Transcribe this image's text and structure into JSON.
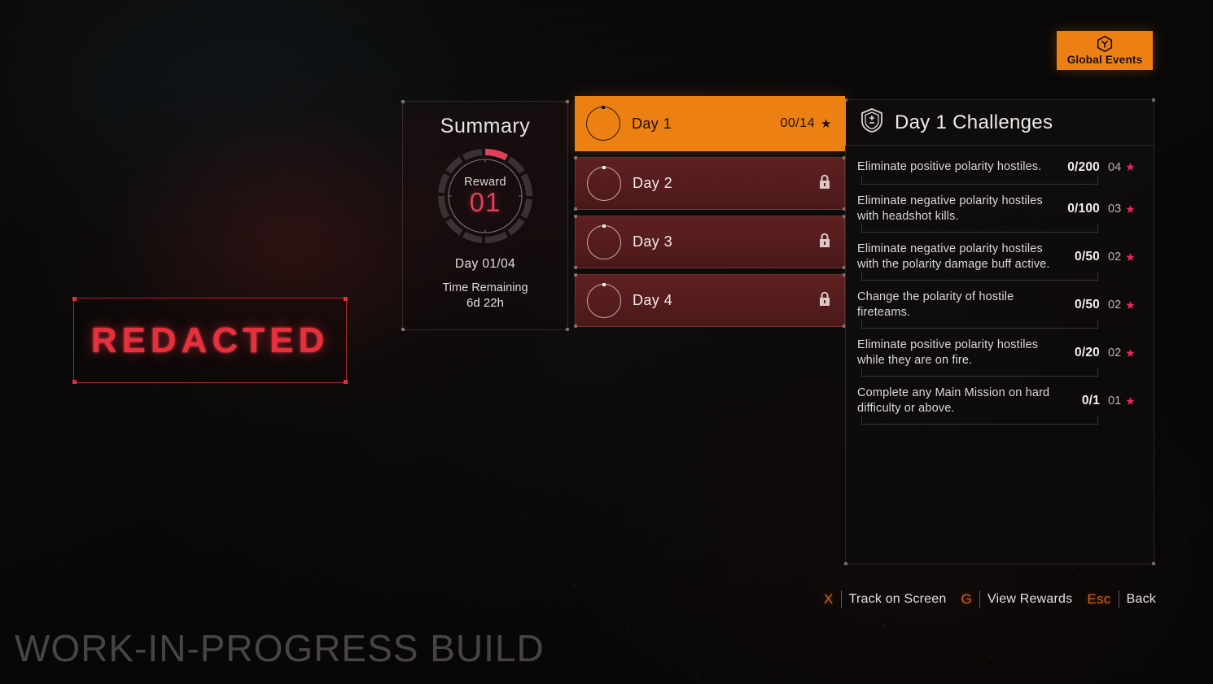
{
  "global_events_button": {
    "label": "Global Events",
    "icon": "global-events-cube-icon",
    "color": "#ED8013"
  },
  "redacted": {
    "text": "REDACTED",
    "color": "#e8303c"
  },
  "summary": {
    "title": "Summary",
    "reward_label": "Reward",
    "reward_value": "01",
    "day_progress": "Day 01/04",
    "time_remaining_label": "Time Remaining",
    "time_remaining_value": "6d 22h",
    "ring_segments": 12,
    "ring_filled_segments": 1,
    "ring_accent_color": "#e0405c"
  },
  "day_tabs": [
    {
      "label": "Day 1",
      "state": "active",
      "count": "00/14",
      "star": "★",
      "locked": false
    },
    {
      "label": "Day 2",
      "state": "locked",
      "count": "",
      "star": "",
      "locked": true
    },
    {
      "label": "Day 3",
      "state": "locked",
      "count": "",
      "star": "",
      "locked": true
    },
    {
      "label": "Day 4",
      "state": "locked",
      "count": "",
      "star": "",
      "locked": true
    }
  ],
  "challenges_panel": {
    "title": "Day 1 Challenges",
    "icon": "shield-challenge-icon",
    "rows": [
      {
        "description": "Eliminate positive polarity hostiles.",
        "progress": "0/200",
        "stars": "04",
        "star_glyph": "★"
      },
      {
        "description": "Eliminate negative polarity hostiles with headshot kills.",
        "progress": "0/100",
        "stars": "03",
        "star_glyph": "★"
      },
      {
        "description": "Eliminate negative polarity hostiles with the polarity damage buff active.",
        "progress": "0/50",
        "stars": "02",
        "star_glyph": "★"
      },
      {
        "description": "Change the polarity of hostile fireteams.",
        "progress": "0/50",
        "stars": "02",
        "star_glyph": "★"
      },
      {
        "description": "Eliminate positive polarity hostiles while they are on fire.",
        "progress": "0/20",
        "stars": "02",
        "star_glyph": "★"
      },
      {
        "description": "Complete any Main Mission on hard difficulty or above.",
        "progress": "0/1",
        "stars": "01",
        "star_glyph": "★"
      }
    ]
  },
  "keybinds": [
    {
      "key": "X",
      "label": "Track on Screen"
    },
    {
      "key": "G",
      "label": "View Rewards"
    },
    {
      "key": "Esc",
      "label": "Back"
    }
  ],
  "watermark": "WORK-IN-PROGRESS BUILD"
}
